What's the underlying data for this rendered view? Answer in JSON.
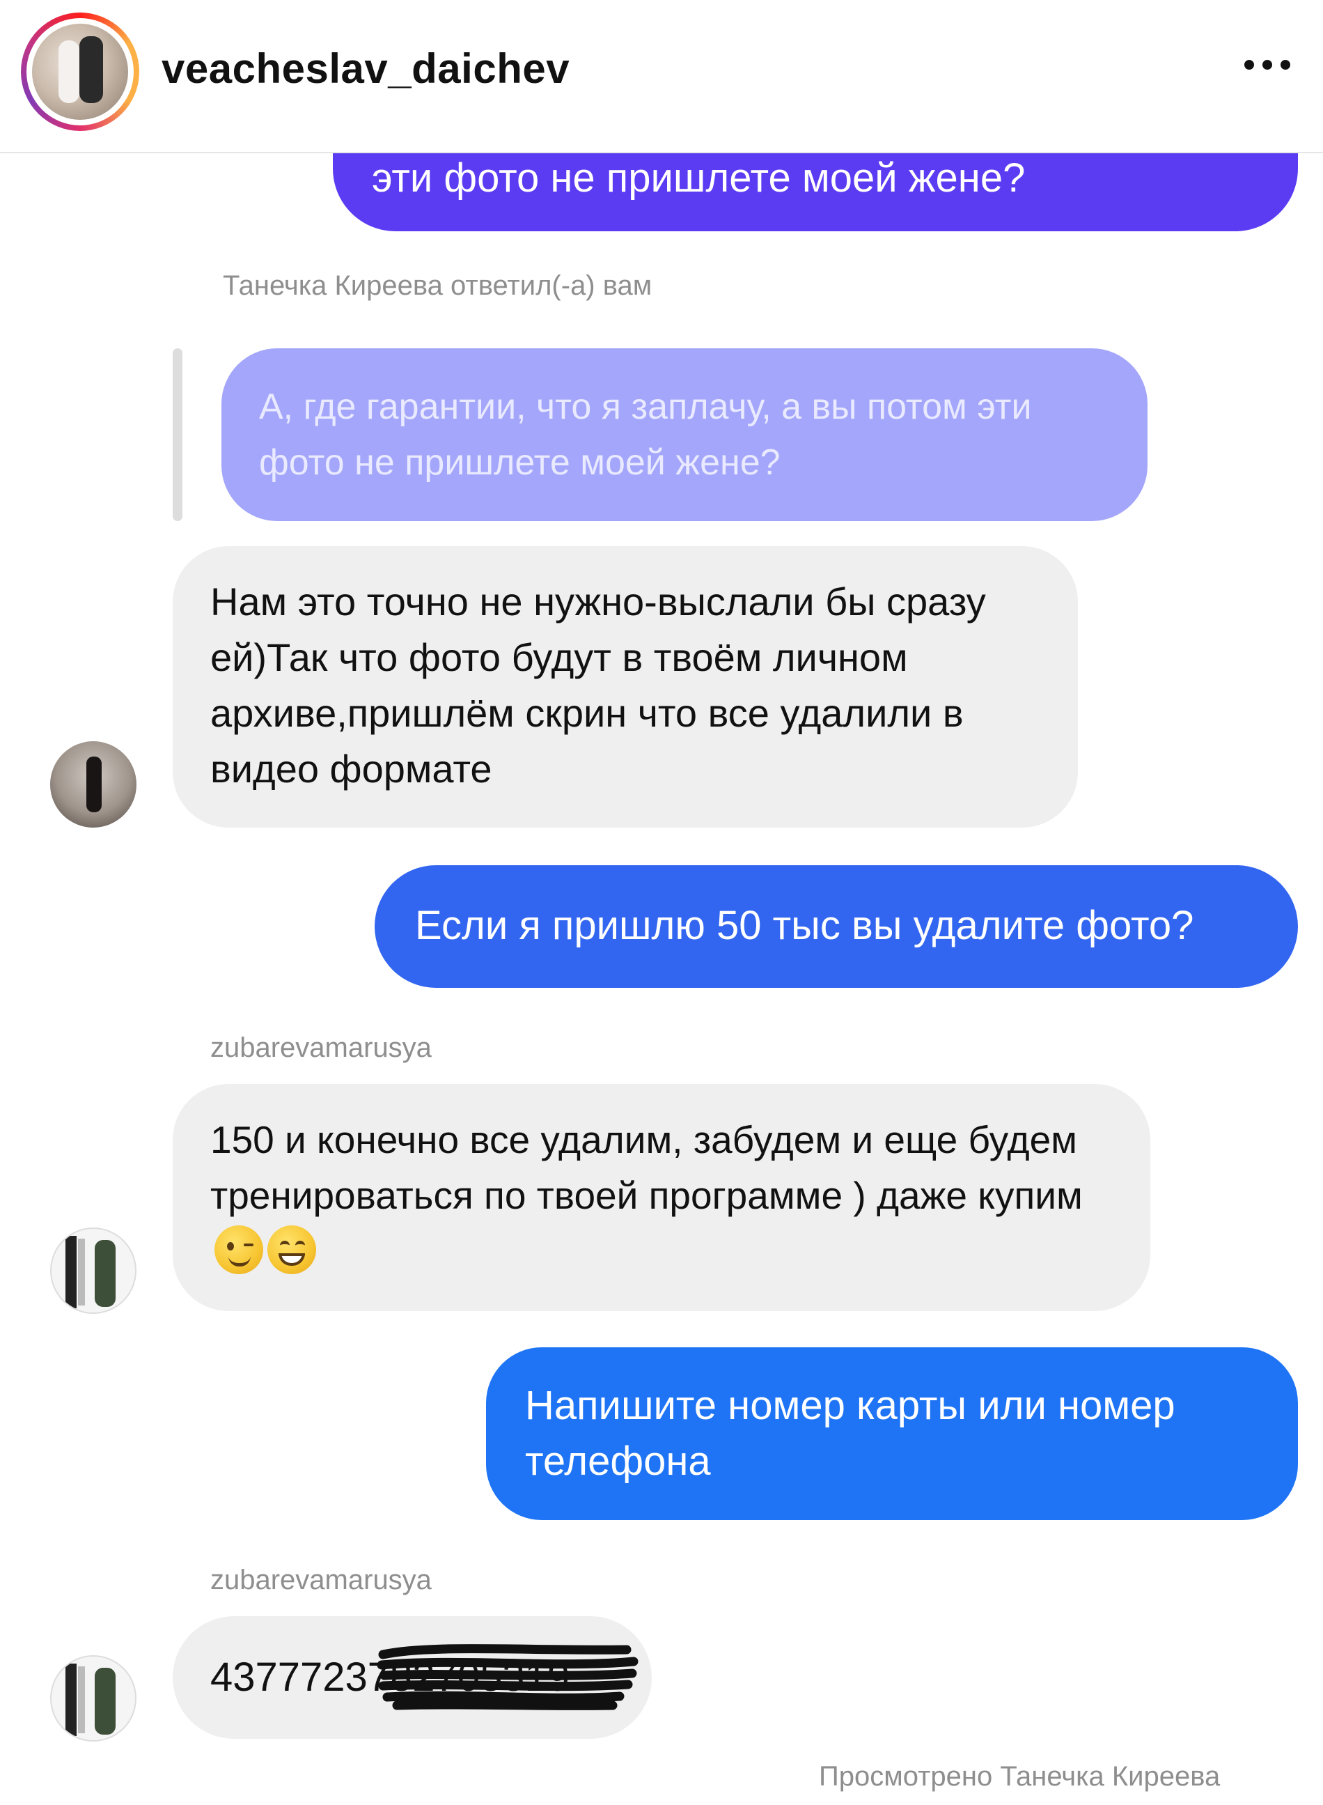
{
  "header": {
    "username": "veacheslav_daichev",
    "more_icon": "more-horizontal-icon"
  },
  "messages": {
    "top_sent": "эти фото не пришлете моей жене?",
    "reply_meta": "Танечка Киреева ответил(-а) вам",
    "quoted": "А, где гарантии, что я заплачу, а вы потом эти фото не пришлете моей жене?",
    "received_1": "Нам это точно не нужно-выслали бы сразу ей)Так что фото будут в твоём личном архиве,пришлём скрин что все удалили в видео формате",
    "sent_1": "Если я пришлю 50 тыс вы удалите фото?",
    "sender_2": "zubarevamarusya",
    "received_2": "150 и конечно все удалим, забудем и еще будем тренироваться по твоей программе ) даже купим",
    "sent_2": "Напишите номер карты или номер телефона",
    "sender_3": "zubarevamarusya",
    "received_3": "4377723782705319",
    "seen": "Просмотрено Танечка Киреева"
  },
  "colors": {
    "sent_purple": "#5b3cf3",
    "quoted_bg": "#a3a6fa",
    "sent_blue": "#3265f0",
    "sent_blue_2": "#1e74f5",
    "received_bg": "#efefef"
  },
  "emojis": [
    "winking-face-icon",
    "grinning-face-icon"
  ]
}
